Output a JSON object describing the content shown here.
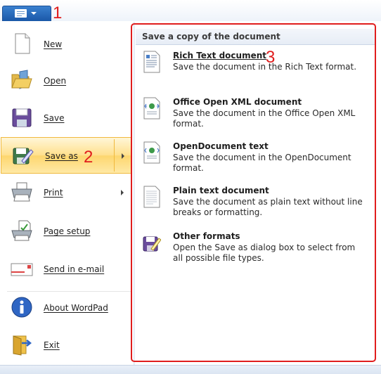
{
  "callouts": {
    "one": "1",
    "two": "2",
    "three": "3"
  },
  "app_button": {
    "icon": "document-icon",
    "dropdown": "chevron-down-icon"
  },
  "menu": {
    "items": [
      {
        "label": "New",
        "icon": "new-document-icon"
      },
      {
        "label": "Open",
        "icon": "folder-open-icon"
      },
      {
        "label": "Save",
        "icon": "floppy-disk-icon"
      },
      {
        "label": "Save as",
        "icon": "save-as-icon",
        "submenu": true,
        "highlighted": true
      },
      {
        "label": "Print",
        "icon": "printer-icon",
        "submenu": true
      },
      {
        "label": "Page setup",
        "icon": "page-setup-icon"
      },
      {
        "label": "Send in e-mail",
        "icon": "email-icon"
      },
      {
        "label": "About WordPad",
        "icon": "info-icon"
      },
      {
        "label": "Exit",
        "icon": "exit-icon"
      }
    ]
  },
  "panel": {
    "header": "Save a copy of the document",
    "options": [
      {
        "title": "Rich Text document",
        "desc": "Save the document in the Rich Text format.",
        "icon": "rtf-document-icon"
      },
      {
        "title": "Office Open XML document",
        "desc": "Save the document in the Office Open XML format.",
        "icon": "xml-document-icon"
      },
      {
        "title": "OpenDocument text",
        "desc": "Save the document in the OpenDocument format.",
        "icon": "odt-document-icon"
      },
      {
        "title": "Plain text document",
        "desc": "Save the document as plain text without line breaks or formatting.",
        "icon": "plain-text-icon"
      },
      {
        "title": "Other formats",
        "desc": "Open the Save as dialog box to select from all possible file types.",
        "icon": "save-as-icon"
      }
    ]
  },
  "colors": {
    "callout": "#e01d1d",
    "highlight": "#ffe08c",
    "accent": "#1a58a8"
  }
}
